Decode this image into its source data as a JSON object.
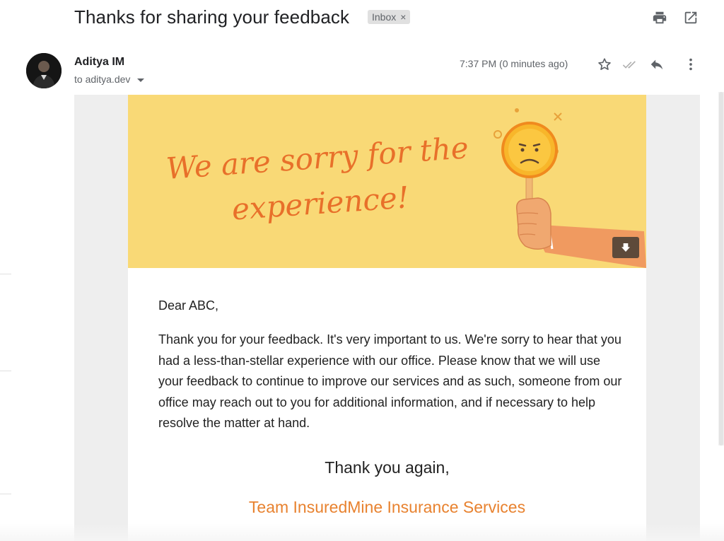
{
  "email": {
    "subject": "Thanks for sharing your feedback",
    "label_chip": "Inbox",
    "label_remove": "×",
    "sender_name": "Aditya IM",
    "recipient_line": "to aditya.dev",
    "timestamp": "7:37 PM (0 minutes ago)"
  },
  "toolbar": {
    "print_icon": "print-icon",
    "open_new_window_icon": "open-in-new-window-icon",
    "star_icon": "star-icon",
    "read_check_icon": "double-check-icon",
    "reply_icon": "reply-icon",
    "more_icon": "more-vertical-icon"
  },
  "banner": {
    "headline_line1": "We are sorry for the",
    "headline_line2": "experience!",
    "background_color": "#f9d976",
    "text_color": "#e8702a"
  },
  "message": {
    "greeting": "Dear ABC,",
    "paragraph": "Thank you for your feedback. It's very important to us. We're sorry to hear that you had a less-than-stellar experience with our office. Please know that we will use your feedback to continue to improve our services and as such, someone from our office may reach out to you for additional information, and if necessary to help resolve the matter at hand.",
    "closing": "Thank you again,",
    "signature": "Team InsuredMine Insurance Services",
    "signature_color": "#e8822f"
  }
}
